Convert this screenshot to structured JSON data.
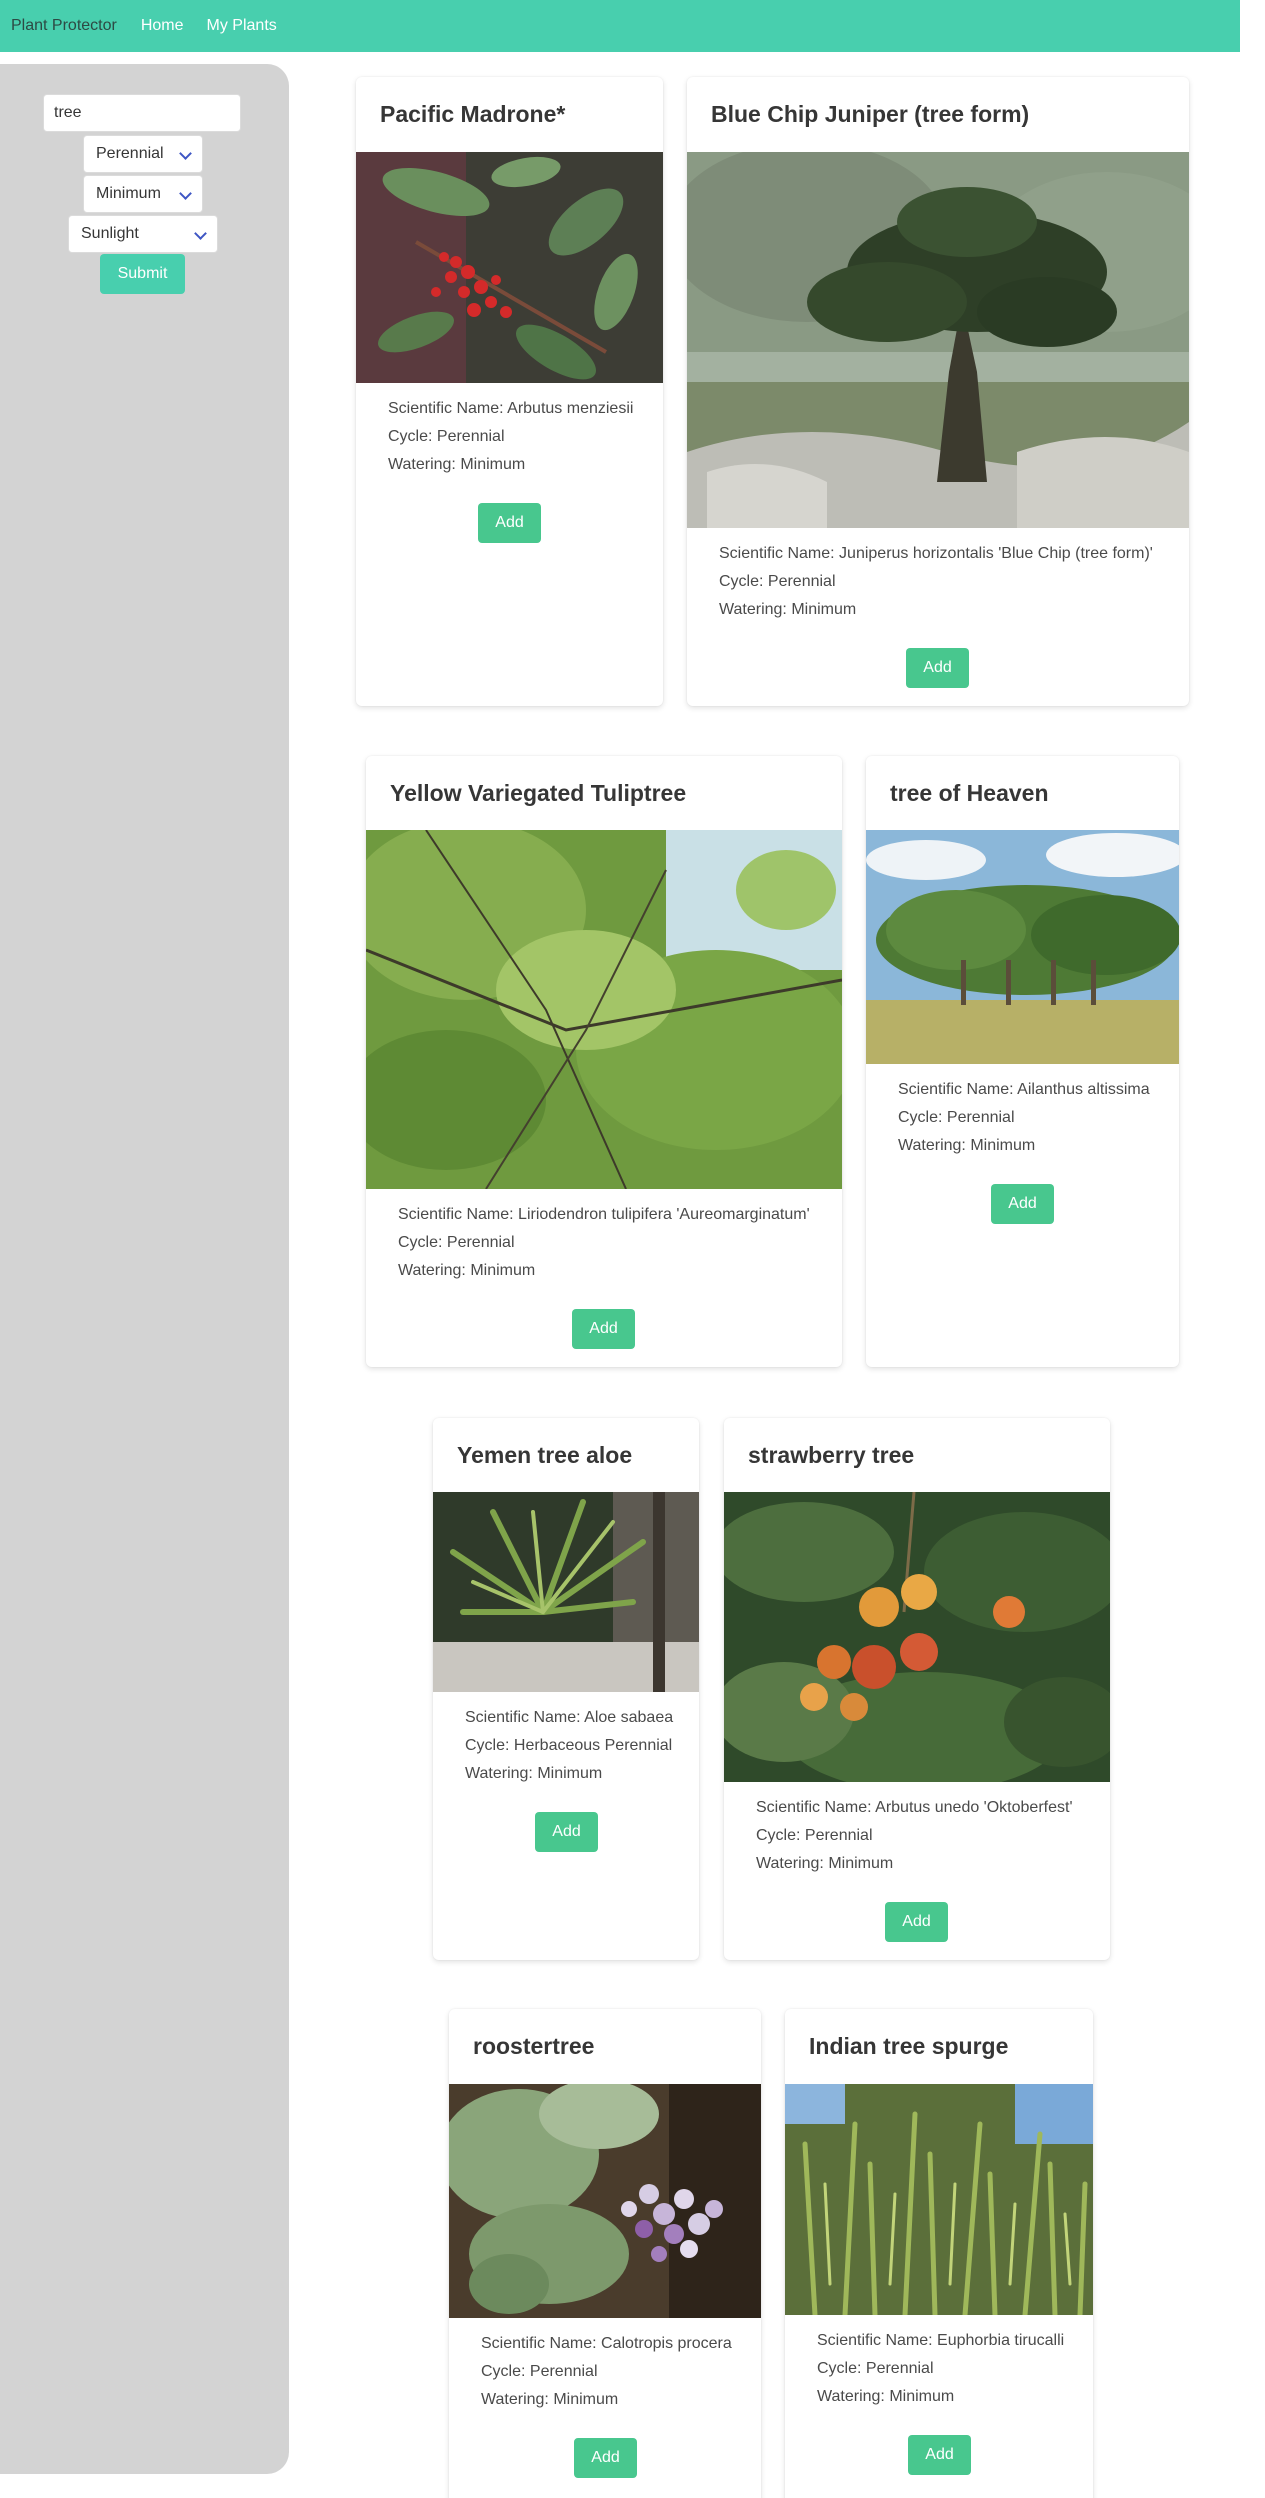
{
  "nav": {
    "brand": "Plant Protector",
    "home": "Home",
    "my_plants": "My Plants"
  },
  "filters": {
    "search_value": "tree",
    "cycle": "Perennial",
    "watering": "Minimum",
    "sunlight": "Sunlight",
    "submit": "Submit"
  },
  "colors": {
    "navbar": "#48cfae",
    "sidebar": "#d3d3d3",
    "add_button": "#48c78e"
  },
  "plants": [
    {
      "title": "Pacific Madrone*",
      "scientific": "Scientific Name: Arbutus menziesii",
      "cycle": "Cycle: Perennial",
      "watering": "Watering: Minimum",
      "add": "Add"
    },
    {
      "title": "Blue Chip Juniper (tree form)",
      "scientific": "Scientific Name: Juniperus horizontalis 'Blue Chip (tree form)'",
      "cycle": "Cycle: Perennial",
      "watering": "Watering: Minimum",
      "add": "Add"
    },
    {
      "title": "Yellow Variegated Tuliptree",
      "scientific": "Scientific Name: Liriodendron tulipifera 'Aureomarginatum'",
      "cycle": "Cycle: Perennial",
      "watering": "Watering: Minimum",
      "add": "Add"
    },
    {
      "title": "tree of Heaven",
      "scientific": "Scientific Name: Ailanthus altissima",
      "cycle": "Cycle: Perennial",
      "watering": "Watering: Minimum",
      "add": "Add"
    },
    {
      "title": "Yemen tree aloe",
      "scientific": "Scientific Name: Aloe sabaea",
      "cycle": "Cycle: Herbaceous Perennial",
      "watering": "Watering: Minimum",
      "add": "Add"
    },
    {
      "title": "strawberry tree",
      "scientific": "Scientific Name: Arbutus unedo 'Oktoberfest'",
      "cycle": "Cycle: Perennial",
      "watering": "Watering: Minimum",
      "add": "Add"
    },
    {
      "title": "roostertree",
      "scientific": "Scientific Name: Calotropis procera",
      "cycle": "Cycle: Perennial",
      "watering": "Watering: Minimum",
      "add": "Add"
    },
    {
      "title": "Indian tree spurge",
      "scientific": "Scientific Name: Euphorbia tirucalli",
      "cycle": "Cycle: Perennial",
      "watering": "Watering: Minimum",
      "add": "Add"
    }
  ]
}
